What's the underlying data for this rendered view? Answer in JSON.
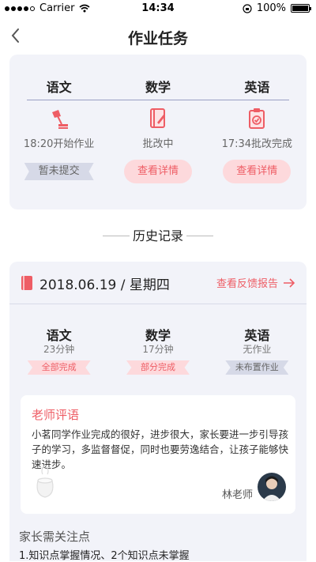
{
  "status_bar": {
    "carrier": "Carrier",
    "time": "14:34",
    "battery": "100%"
  },
  "nav": {
    "title": "作业任务"
  },
  "tasks": [
    {
      "subject": "语文",
      "icon": "lamp-icon",
      "status": "18:20开始作业",
      "action": "暂未提交",
      "action_style": "ribbon"
    },
    {
      "subject": "数学",
      "icon": "notebook-icon",
      "status": "批改中",
      "action": "查看详情",
      "action_style": "pill"
    },
    {
      "subject": "英语",
      "icon": "clipboard-check-icon",
      "status": "17:34批改完成",
      "action": "查看详情",
      "action_style": "pill"
    }
  ],
  "history_title": "历史记录",
  "record": {
    "date": "2018.06.19 / 星期四",
    "feedback_link": "查看反馈报告",
    "subjects": [
      {
        "subject": "语文",
        "duration": "23分钟",
        "tag": "全部完成"
      },
      {
        "subject": "数学",
        "duration": "17分钟",
        "tag": "部分完成"
      },
      {
        "subject": "英语",
        "duration": "无作业",
        "tag": "未布置作业"
      }
    ],
    "comment": {
      "title": "老师评语",
      "text": "小茗同学作业完成的很好，进步很大，家长要进一步引导孩子的学习，多监督督促，同时也要劳逸结合，让孩子能够快速进步。",
      "teacher": "林老师"
    },
    "notes": {
      "title": "家长需关注点",
      "text": "1.知识点掌握情况、2个知识点未掌握"
    }
  },
  "colors": {
    "accent": "#ee5d65",
    "card_bg": "#f2f3f9",
    "pill_bg": "#fdd9dc",
    "ribbon_bg": "#d6d9e7"
  }
}
